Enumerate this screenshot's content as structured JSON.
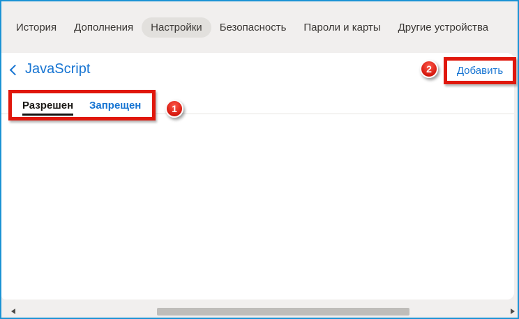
{
  "nav": {
    "tabs": [
      {
        "label": "История",
        "active": false
      },
      {
        "label": "Дополнения",
        "active": false
      },
      {
        "label": "Настройки",
        "active": true
      },
      {
        "label": "Безопасность",
        "active": false
      },
      {
        "label": "Пароли и карты",
        "active": false
      },
      {
        "label": "Другие устройства",
        "active": false
      }
    ]
  },
  "page": {
    "title": "JavaScript",
    "add_link": "Добавить",
    "filter_tabs": [
      {
        "label": "Разрешен",
        "active": true
      },
      {
        "label": "Запрещен",
        "active": false
      }
    ]
  },
  "annotations": {
    "step_badges": [
      "1",
      "2"
    ]
  },
  "colors": {
    "frame_blue": "#1b93d4",
    "link_blue": "#1674d2",
    "highlight_red": "#e0170c",
    "nav_background": "#f1efee",
    "active_pill": "#e2e0dd",
    "scroll_thumb": "#bfbdba"
  }
}
